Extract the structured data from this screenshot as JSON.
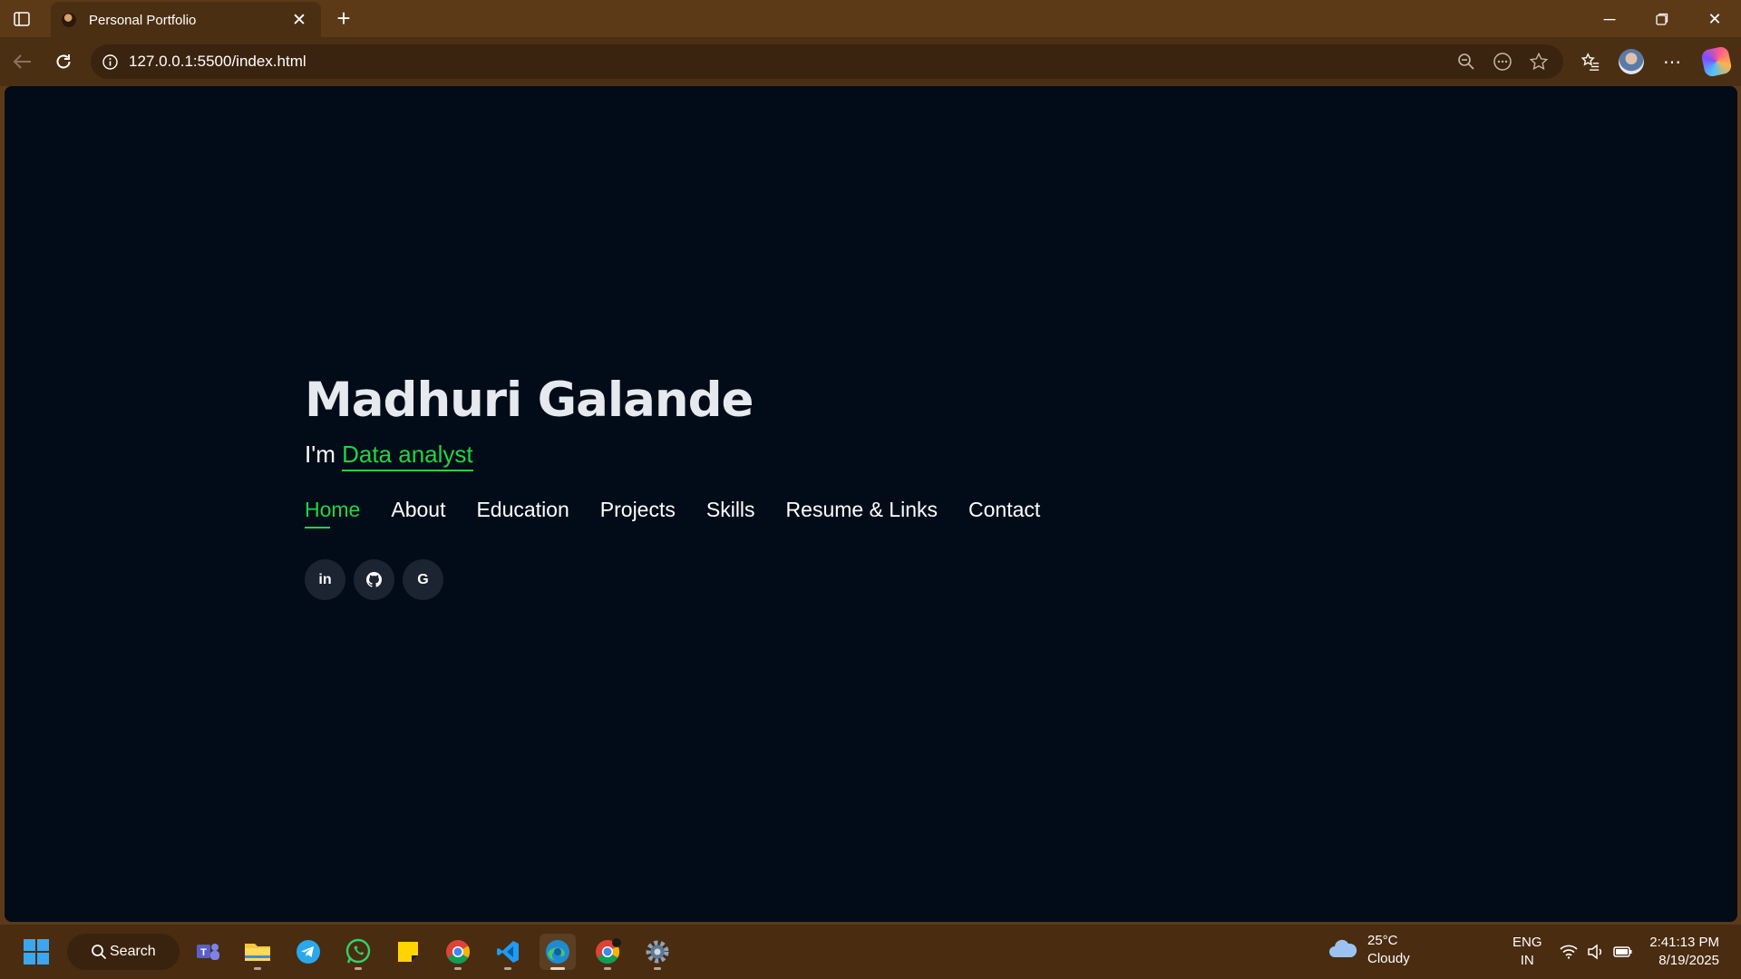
{
  "browser": {
    "tab_title": "Personal Portfolio",
    "url": "127.0.0.1:5500/index.html"
  },
  "page": {
    "name": "Madhuri Galande",
    "intro_prefix": "I'm",
    "role": "Data analyst",
    "nav": [
      {
        "label": "Home",
        "active": true
      },
      {
        "label": "About"
      },
      {
        "label": "Education"
      },
      {
        "label": "Projects"
      },
      {
        "label": "Skills"
      },
      {
        "label": "Resume & Links"
      },
      {
        "label": "Contact"
      }
    ],
    "socials": [
      {
        "icon": "linkedin-icon",
        "glyph": "in"
      },
      {
        "icon": "github-icon",
        "glyph": ""
      },
      {
        "icon": "google-icon",
        "glyph": "G"
      }
    ],
    "accent_color": "#22d344",
    "background_color": "#020c18"
  },
  "taskbar": {
    "search_label": "Search",
    "weather_temp": "25°C",
    "weather_desc": "Cloudy",
    "lang_1": "ENG",
    "lang_2": "IN",
    "time": "2:41:13 PM",
    "date": "8/19/2025",
    "apps": [
      "windows-start-icon",
      "teams-icon",
      "file-explorer-icon",
      "telegram-icon",
      "whatsapp-icon",
      "sticky-notes-icon",
      "chrome-icon",
      "vscode-icon",
      "edge-icon",
      "chrome-icon-2",
      "settings-icon"
    ]
  }
}
